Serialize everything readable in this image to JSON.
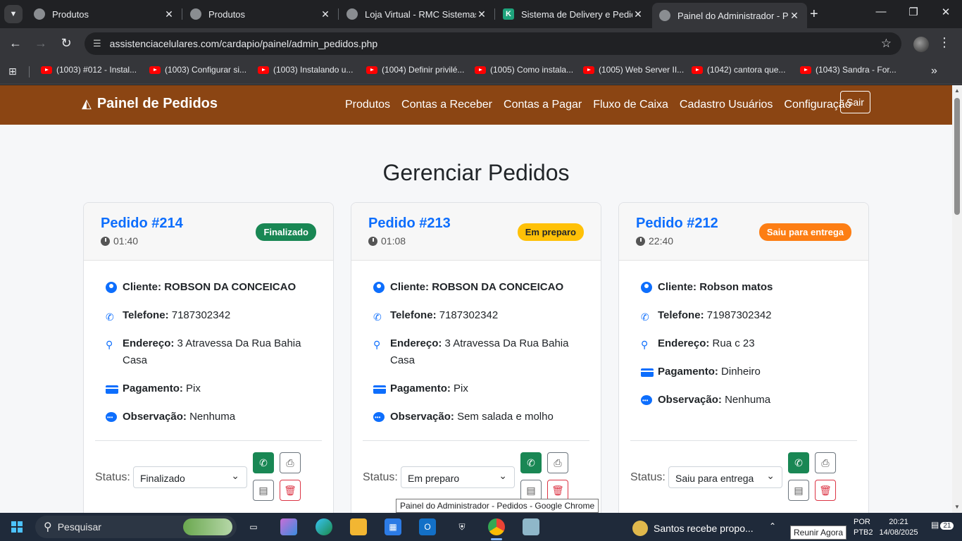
{
  "browser": {
    "tabs": [
      {
        "title": "Produtos",
        "favicon": "globe-icon"
      },
      {
        "title": "Produtos",
        "favicon": "globe-icon"
      },
      {
        "title": "Loja Virtual - RMC Sistemas",
        "favicon": "globe-icon"
      },
      {
        "title": "Sistema de Delivery e Pedidos",
        "favicon": "k-icon"
      },
      {
        "title": "Painel do Administrador - Pedidos",
        "favicon": "globe-icon",
        "active": true
      }
    ],
    "k_letter": "K",
    "url": "assistenciacelulares.com/cardapio/painel/admin_pedidos.php",
    "bookmarks": [
      "(1003) #012 - Instal...",
      "(1003) Configurar si...",
      "(1003) Instalando u...",
      "(1004) Definir privilé...",
      "(1005) Como instala...",
      "(1005) Web Server II...",
      "(1042) cantora que...",
      "(1043) Sandra - For..."
    ]
  },
  "app": {
    "brand": "Painel de Pedidos",
    "nav": [
      "Produtos",
      "Contas a Receber",
      "Contas a Pagar",
      "Fluxo de Caixa",
      "Cadastro Usuários",
      "Configuração"
    ],
    "logout": "Sair",
    "page_title": "Gerenciar Pedidos",
    "labels": {
      "cliente": "Cliente:",
      "telefone": "Telefone:",
      "endereco": "Endereço:",
      "pagamento": "Pagamento:",
      "observacao": "Observação:",
      "status": "Status:"
    },
    "orders": [
      {
        "number": "Pedido #214",
        "time": "01:40",
        "badge": "Finalizado",
        "badge_color": "#198754",
        "cliente": "ROBSON DA CONCEICAO",
        "telefone": "7187302342",
        "endereco": "3 Atravessa Da Rua Bahia Casa",
        "pagamento": "Pix",
        "observacao": "Nenhuma",
        "status": "Finalizado"
      },
      {
        "number": "Pedido #213",
        "time": "01:08",
        "badge": "Em preparo",
        "badge_color": "#ffc107",
        "cliente": "ROBSON DA CONCEICAO",
        "telefone": "7187302342",
        "endereco": "3 Atravessa Da Rua Bahia Casa",
        "pagamento": "Pix",
        "observacao": "Sem salada e molho",
        "status": "Em preparo"
      },
      {
        "number": "Pedido #212",
        "time": "22:40",
        "badge": "Saiu para entrega",
        "badge_color": "#fd7e14",
        "cliente": "Robson matos",
        "telefone": "71987302342",
        "endereco": "Rua c 23",
        "pagamento": "Dinheiro",
        "observacao": "Nenhuma",
        "status": "Saiu para entrega"
      }
    ],
    "tooltip": "Painel do Administrador - Pedidos - Google Chrome"
  },
  "taskbar": {
    "search_placeholder": "Pesquisar",
    "news": "Santos recebe propo...",
    "lang_1": "POR",
    "lang_2": "PTB2",
    "time": "20:21",
    "date": "14/08/2025",
    "notif_count": "21",
    "tooltip": "Reunir Agora"
  }
}
